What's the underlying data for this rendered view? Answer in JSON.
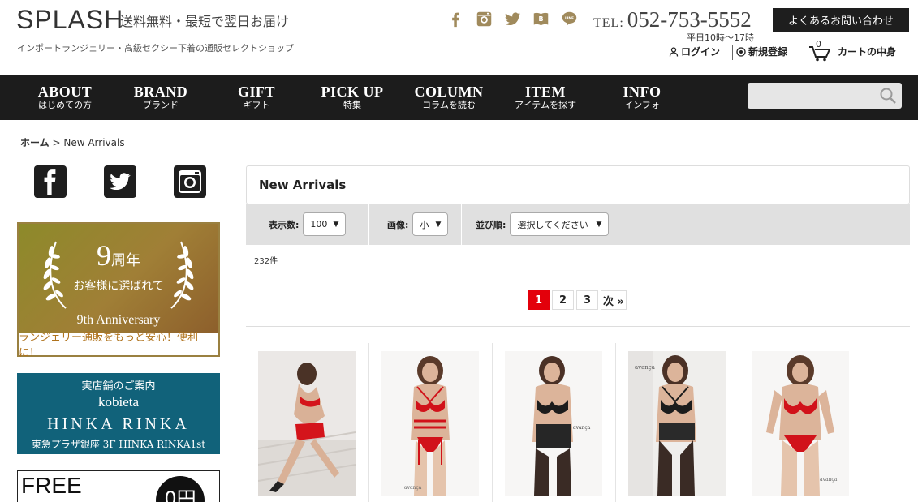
{
  "header": {
    "logo": "SPLASH",
    "tagline": "送料無料・最短で翌日お届け",
    "subline": "インポートランジェリー・高級セクシー下着の通販セレクトショップ",
    "tel_label": "TEL:",
    "tel_number": "052-753-5552",
    "hours": "平日10時～17時",
    "faq_button": "よくあるお問い合わせ",
    "login": "ログイン",
    "register": "新規登録",
    "cart_label": "カートの中身",
    "cart_count": "0",
    "socials": [
      "facebook-icon",
      "instagram-icon",
      "twitter-icon",
      "hatena-bookmark-icon",
      "line-icon"
    ]
  },
  "nav": {
    "items": [
      {
        "en": "ABOUT",
        "jp": "はじめての方"
      },
      {
        "en": "BRAND",
        "jp": "ブランド"
      },
      {
        "en": "GIFT",
        "jp": "ギフト"
      },
      {
        "en": "PICK UP",
        "jp": "特集"
      },
      {
        "en": "COLUMN",
        "jp": "コラムを読む"
      },
      {
        "en": "ITEM",
        "jp": "アイテムを探す"
      },
      {
        "en": "INFO",
        "jp": "インフォ"
      }
    ],
    "search_placeholder": ""
  },
  "breadcrumb": {
    "home": "ホーム",
    "separator": ">",
    "current": "New Arrivals"
  },
  "sidebar": {
    "anniversary": {
      "number": "9",
      "unit": "周年",
      "sub": "お客様に選ばれて",
      "en": "9th Anniversary",
      "footer": "ランジェリー通販をもっと安心！便利に！"
    },
    "shop": {
      "line1": "実店舗のご案内",
      "line2": "kobieta",
      "line3": "HINKA RINKA",
      "line4": "東急プラザ銀座 3F HINKA RINKA1st"
    },
    "free": {
      "text": "FREE",
      "circle": "0円"
    }
  },
  "main": {
    "title": "New Arrivals",
    "filters": {
      "per_page_label": "表示数:",
      "per_page_value": "100",
      "image_label": "画像:",
      "image_value": "小",
      "sort_label": "並び順:",
      "sort_value": "選択してください"
    },
    "count": "232件",
    "pager": [
      "1",
      "2",
      "3"
    ],
    "pager_next": "次 »",
    "products": [
      {
        "style": "red-seated",
        "brand": "avança"
      },
      {
        "style": "red-strappy",
        "brand": "avança"
      },
      {
        "style": "black-lace",
        "brand": "avança"
      },
      {
        "style": "black-strappy",
        "brand": "avança"
      },
      {
        "style": "red-set",
        "brand": "avança"
      }
    ]
  },
  "colors": {
    "nav_bg": "#1c1c1c",
    "accent_gold": "#a08a5c",
    "pager_active": "#e3000b",
    "shop_banner": "#11627a"
  }
}
